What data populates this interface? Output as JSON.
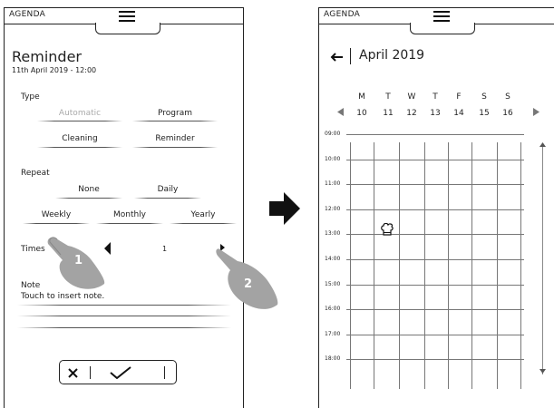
{
  "left": {
    "app_title": "AGENDA",
    "page_title": "Reminder",
    "datetime": "11th April 2019 - 12:00",
    "type_label": "Type",
    "type_options": [
      "Automatic",
      "Program",
      "Cleaning",
      "Reminder"
    ],
    "repeat_label": "Repeat",
    "repeat_options": [
      "None",
      "Daily",
      "Weekly",
      "Monthly",
      "Yearly"
    ],
    "times_label": "Times",
    "times_value": "1",
    "note_label": "Note",
    "note_placeholder": "Touch to insert note.",
    "callout_1": "1",
    "callout_2": "2"
  },
  "right": {
    "app_title": "AGENDA",
    "month_title": "April 2019",
    "day_letters": [
      "M",
      "T",
      "W",
      "T",
      "F",
      "S",
      "S"
    ],
    "day_numbers": [
      "10",
      "11",
      "12",
      "13",
      "14",
      "15",
      "16"
    ],
    "times": [
      "09:00",
      "10:00",
      "11:00",
      "12:00",
      "13:00",
      "14:00",
      "15:00",
      "16:00",
      "17:00",
      "18:00"
    ]
  },
  "icons": [
    "menu-icon",
    "arrow-right-icon",
    "back-arrow-icon",
    "chevron-left-icon",
    "chevron-right-icon",
    "chef-hat-icon",
    "close-icon",
    "check-icon"
  ]
}
